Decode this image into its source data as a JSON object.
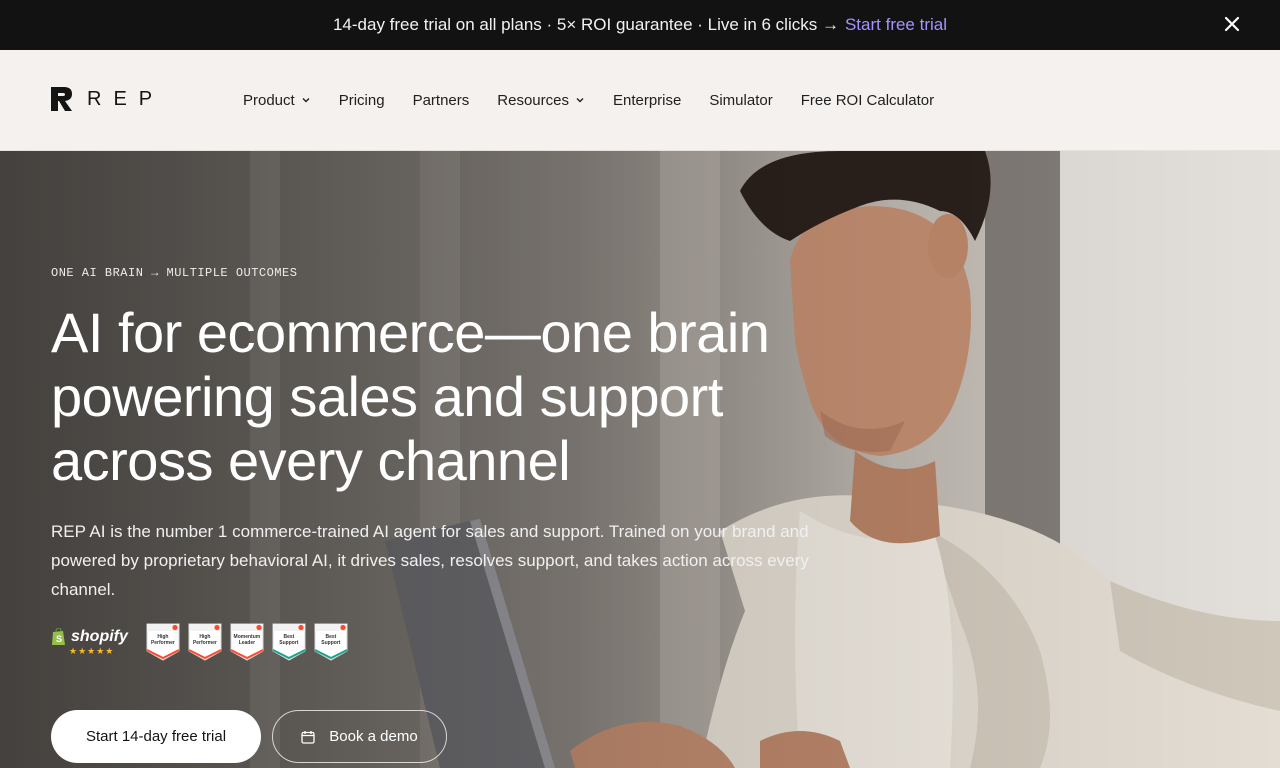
{
  "announcement": {
    "text": "14-day free trial on all plans · 5× ROI guarantee · Live in 6 clicks →",
    "link_label": "Start free trial",
    "link_color": "#a394ff"
  },
  "header": {
    "logo_text": "REP",
    "nav": [
      {
        "label": "Product",
        "has_dropdown": true
      },
      {
        "label": "Pricing",
        "has_dropdown": false
      },
      {
        "label": "Partners",
        "has_dropdown": false
      },
      {
        "label": "Resources",
        "has_dropdown": true
      },
      {
        "label": "Enterprise",
        "has_dropdown": false
      },
      {
        "label": "Simulator",
        "has_dropdown": false
      },
      {
        "label": "Free ROI Calculator",
        "has_dropdown": false
      }
    ]
  },
  "hero": {
    "eyebrow": "ONE AI BRAIN → MULTIPLE OUTCOMES",
    "headline": "AI for ecommerce—one brain powering sales and support across every channel",
    "subheadline": "REP AI is the number 1 commerce-trained AI agent for sales and support. Trained on your brand and powered by proprietary behavioral AI, it drives sales, resolves support, and takes action across every channel.",
    "shopify_label": "shopify",
    "shopify_stars": "★★★★★",
    "g2_badges": [
      "High Performer",
      "High Performer",
      "Momentum Leader",
      "Best Support",
      "Best Support"
    ],
    "primary_cta": "Start 14-day free trial",
    "secondary_cta": "Book a demo"
  },
  "colors": {
    "announcement_bg": "#121212",
    "header_bg": "#f4f1ee",
    "g2_red": "#ff492c",
    "star": "#f7b928"
  },
  "icons": [
    "close-icon",
    "rep-logo-mark",
    "chevron-down-icon",
    "shopify-bag-icon",
    "g2-badge-icon",
    "calendar-icon"
  ]
}
